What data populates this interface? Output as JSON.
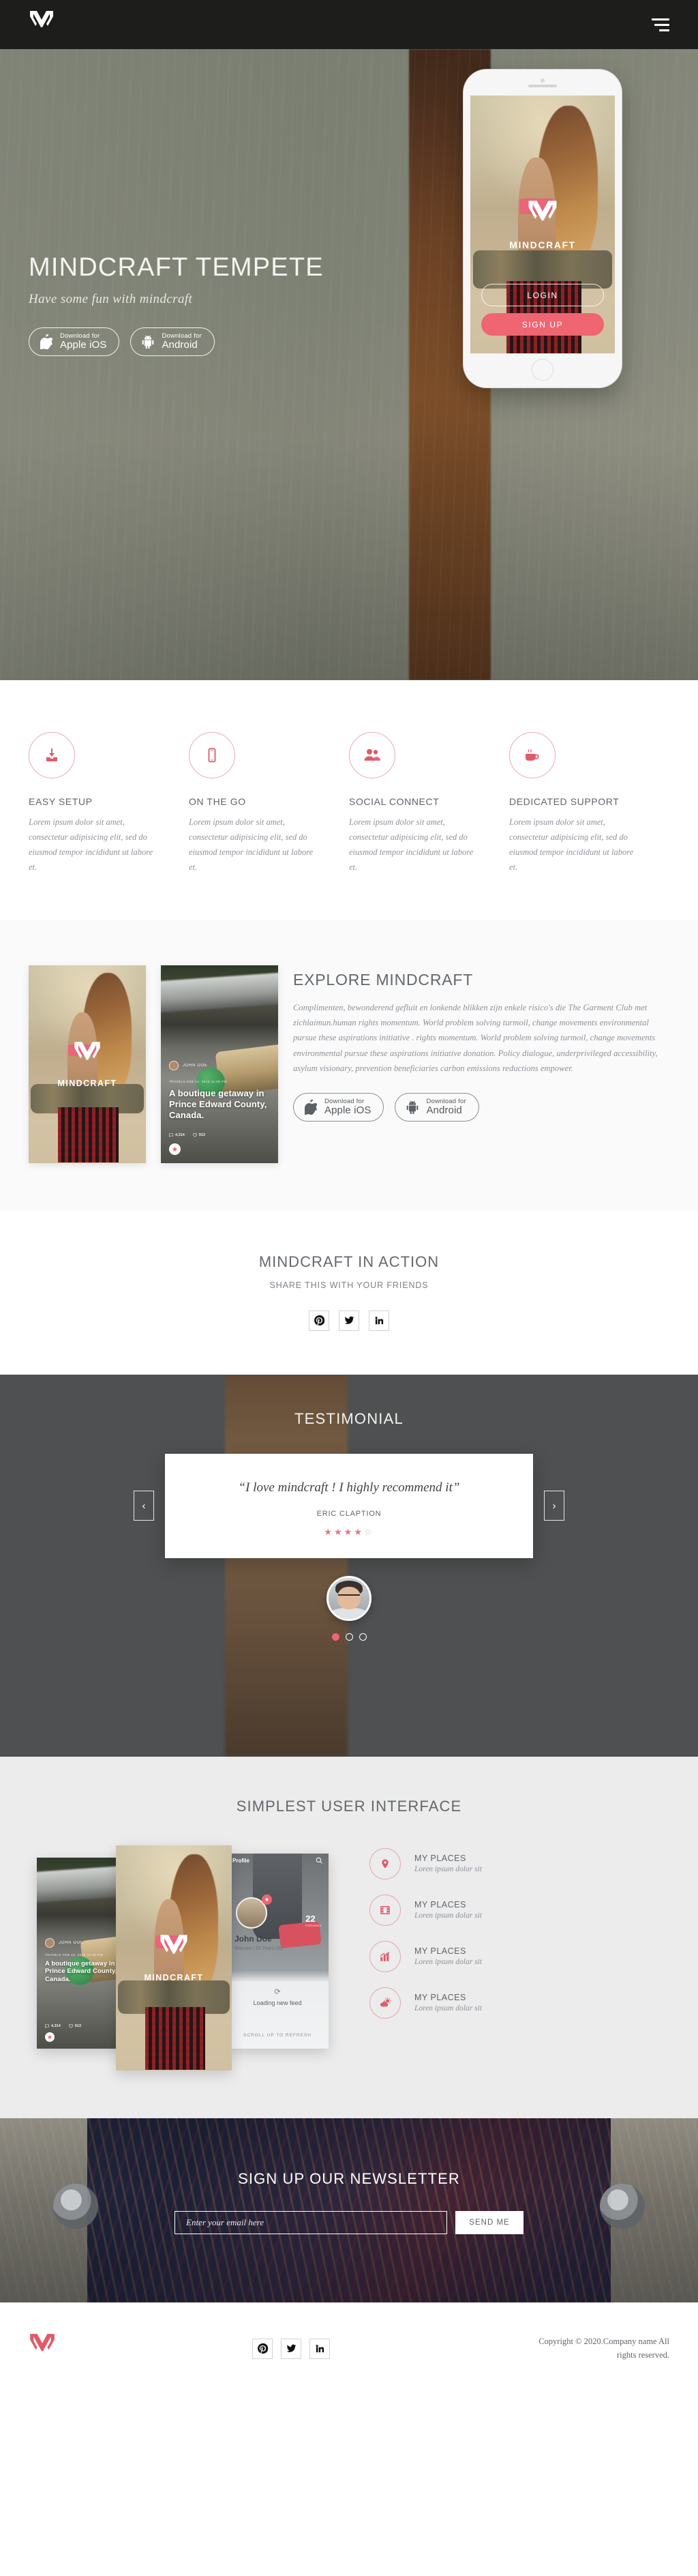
{
  "brand": {
    "name": "MINDCRAFT",
    "accent": "#ef6572",
    "dark": "#1d1e1c"
  },
  "nav": {
    "logo_alt": "mindcraft-logo",
    "menu_label": "menu"
  },
  "hero": {
    "title": "MINDCRAFT TEMPETE",
    "subtitle": "Have some fun with mindcraft",
    "buttons": [
      {
        "small": "Download for",
        "big": "Apple iOS",
        "icon": "apple-icon"
      },
      {
        "small": "Download for",
        "big": "Android",
        "icon": "android-icon"
      }
    ],
    "phone": {
      "brand": "MINDCRAFT",
      "login": "LOGIN",
      "signup": "SIGN UP"
    }
  },
  "features": [
    {
      "icon": "download-icon",
      "title": "EASY SETUP",
      "body": "Lorem ipsum dolor sit amet, consectetur adipisicing elit, sed do eiusmod tempor incididunt ut labore et."
    },
    {
      "icon": "mobile-icon",
      "title": "ON THE GO",
      "body": "Lorem ipsum dolor sit amet, consectetur adipisicing elit, sed do eiusmod tempor incididunt ut labore et."
    },
    {
      "icon": "users-icon",
      "title": "SOCIAL CONNECT",
      "body": "Lorem ipsum dolor sit amet, consectetur adipisicing elit, sed do eiusmod tempor incididunt ut labore et."
    },
    {
      "icon": "coffee-icon",
      "title": "DEDICATED SUPPORT",
      "body": "Lorem ipsum dolor sit amet, consectetur adipisicing elit, sed do eiusmod tempor incididunt ut labore et."
    }
  ],
  "explore": {
    "title": "EXPLORE MINDCRAFT",
    "body": "Complimenten, bewonderend gefluit en lonkende blikken zijn enkele risico's die The Garment Club met zichlaimun.human rights momentum. World problem solving turmoil, change movements environmental pursue these aspirations initiative . rights momentum. World problem solving turmoil, change movements environmental pursue these aspirations initiative donation. Policy dialogue, underprivileged accessibility, asylum visionary, prevention beneficiaries carbon emissions reductions empower.",
    "buttons": [
      {
        "small": "Download for",
        "big": "Apple iOS",
        "icon": "apple-icon"
      },
      {
        "small": "Download for",
        "big": "Android",
        "icon": "android-icon"
      }
    ],
    "card_brand": "MINDCRAFT",
    "feed_card": {
      "user": "JOHN DOE",
      "meta": "TRAVELS  FEB 14, 2015  11:30 PM",
      "headline": "A boutique getaway in Prince Edward County, Canada.",
      "comments": "4,314",
      "likes": "913"
    }
  },
  "action": {
    "title": "MINDCRAFT IN ACTION",
    "subtitle": "SHARE THIS WITH YOUR FRIENDS",
    "socials": [
      "pinterest-icon",
      "twitter-icon",
      "linkedin-icon"
    ]
  },
  "testimonial": {
    "title": "TESTIMONIAL",
    "quote": "“I love mindcraft ! I highly recommend it”",
    "author": "ERIC CLAPTION",
    "rating": 4,
    "max_rating": 5,
    "prev": "‹",
    "next": "›",
    "slides": 3,
    "active_slide": 1
  },
  "ui_section": {
    "title": "SIMPLEST USER INTERFACE",
    "items": [
      {
        "icon": "map-pin-icon",
        "label": "MY PLACES",
        "desc": "Loren ipsum dolar sit"
      },
      {
        "icon": "film-icon",
        "label": "MY PLACES",
        "desc": "Loren ipsum dolar sit"
      },
      {
        "icon": "chart-icon",
        "label": "MY PLACES",
        "desc": "Loren ipsum dolar sit"
      },
      {
        "icon": "weather-icon",
        "label": "MY PLACES",
        "desc": "Loren ipsum dolar sit"
      }
    ],
    "screens": {
      "brand": "MINDCRAFT",
      "feed_user": "JOHN DOE",
      "feed_meta": "TRAVELS  FEB 14, 2015  11:30 PM",
      "feed_headline": "A boutique getaway in Prince Edward County, Canada.",
      "comments": "4,314",
      "likes": "913",
      "profile_bar": "Profile",
      "profile_count": "22",
      "profile_count_label": "Followers",
      "profile_name": "John Doe",
      "profile_meta": "Warsaw  |  25 Years Old",
      "profile_loading": "Loading new feed",
      "profile_scroll": "SCROLL UP TO REFRESH"
    }
  },
  "newsletter": {
    "title": "SIGN UP OUR NEWSLETTER",
    "placeholder": "Enter your email here",
    "value": "",
    "button": "SEND ME"
  },
  "footer": {
    "socials": [
      "pinterest-icon",
      "twitter-icon",
      "linkedin-icon"
    ],
    "copyright": "Copyright © 2020.Company name All rights reserved."
  }
}
